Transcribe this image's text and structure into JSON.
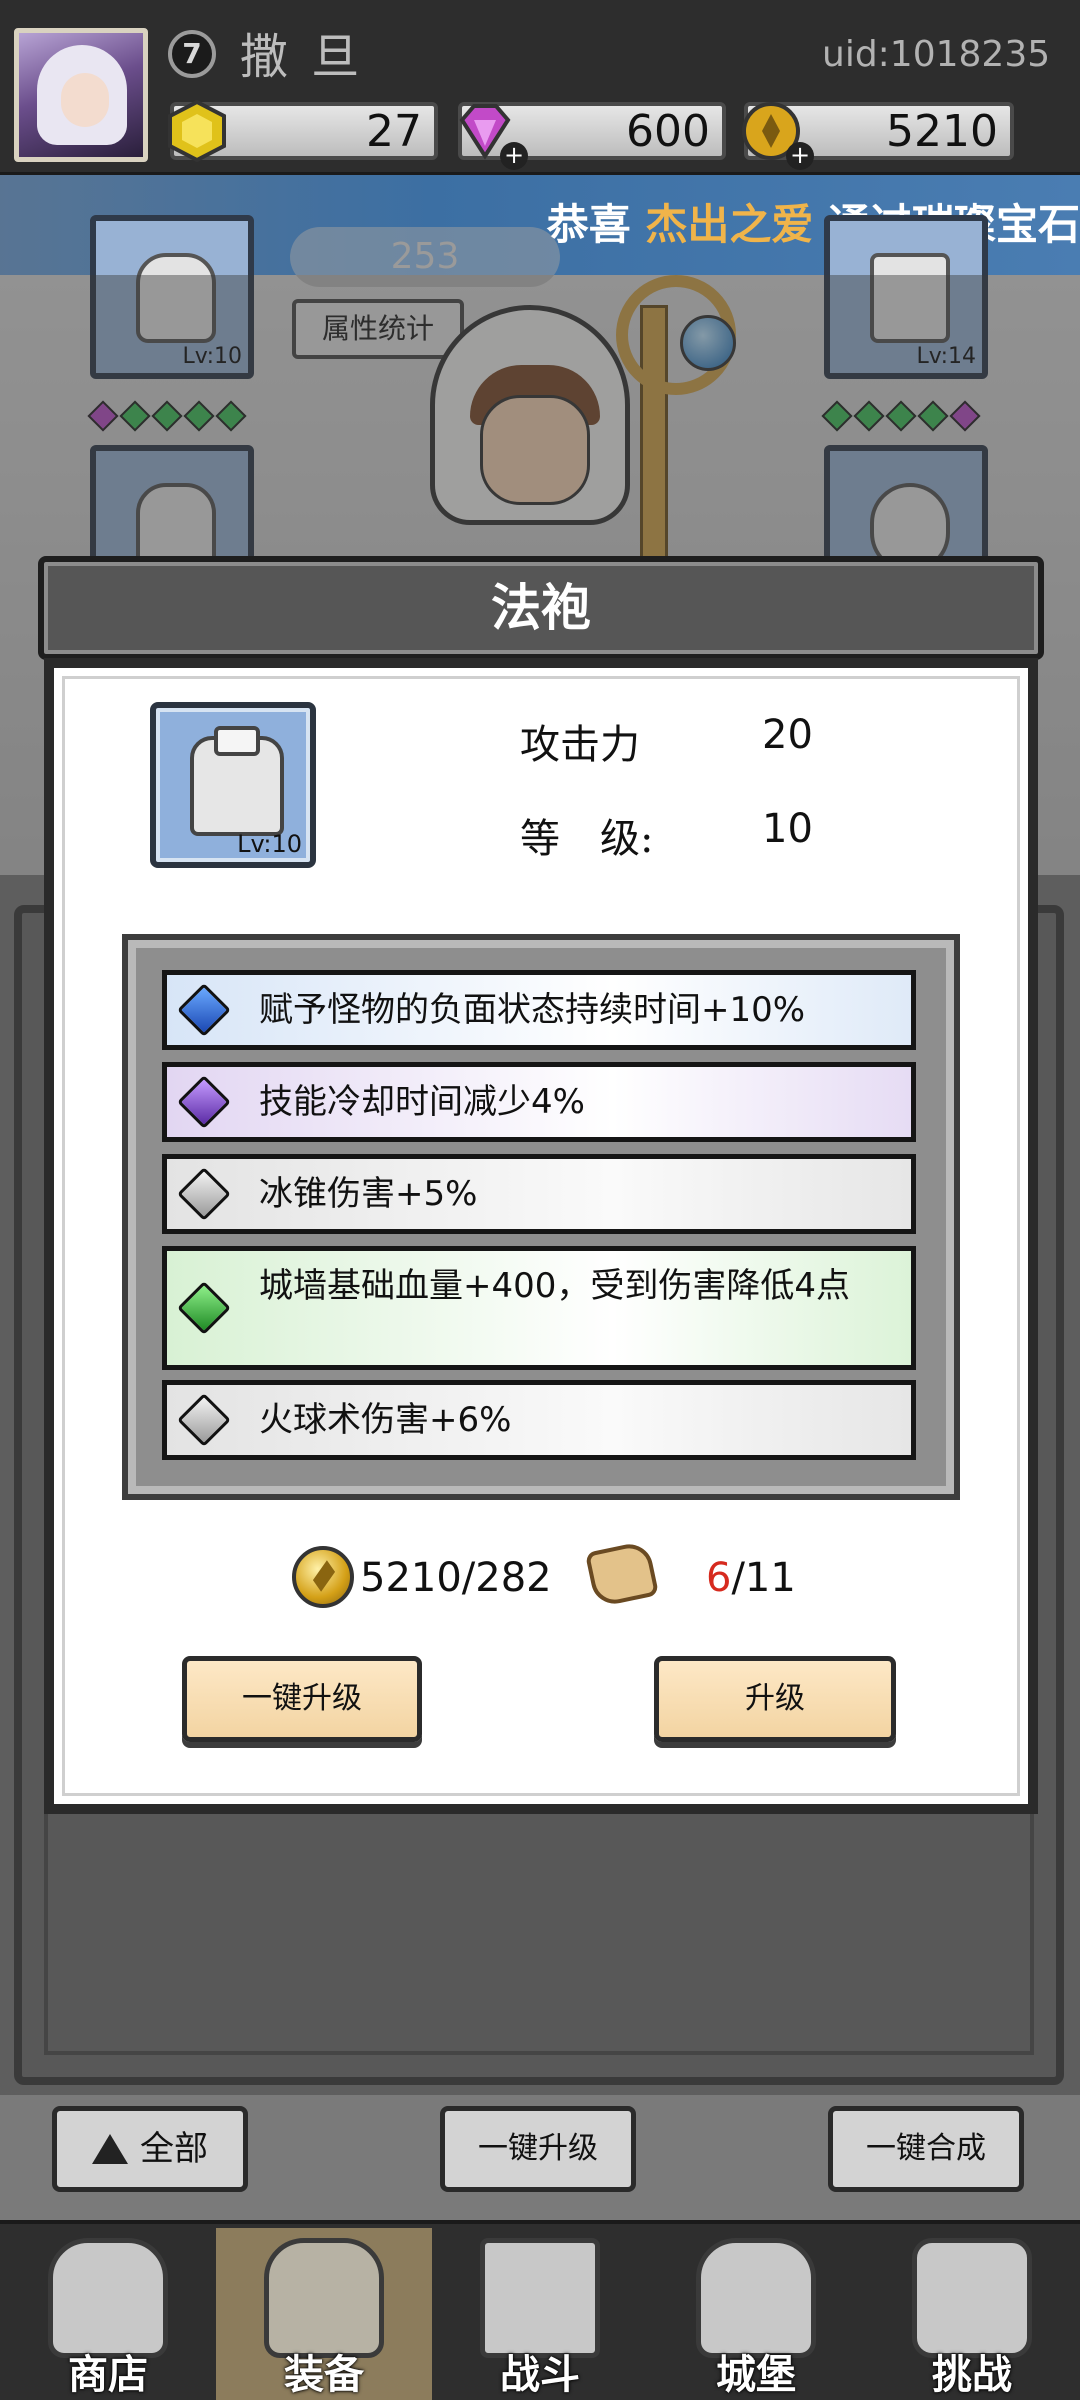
{
  "header": {
    "level": "7",
    "player_name": "撒 旦",
    "uid": "uid:1018235",
    "resources": {
      "gold_gem": "27",
      "diamond": "600",
      "coin": "5210"
    }
  },
  "banner": {
    "prefix": "恭喜",
    "player": "杰出之爱",
    "suffix": "通过璀璨宝石"
  },
  "scene": {
    "power": "253",
    "stat_button": "属性统计",
    "slot_levels": {
      "helmet": "Lv:10",
      "weapon": "Lv:14"
    }
  },
  "modal": {
    "title": "法袍",
    "item_level": "Lv:10",
    "stats": [
      {
        "label": "攻击力",
        "value": "20"
      },
      {
        "label": "等　级:",
        "value": "10"
      }
    ],
    "affixes": [
      {
        "gem": "blue",
        "text": "赋予怪物的负面状态持续时间+10%"
      },
      {
        "gem": "purple",
        "text": "技能冷却时间减少4%"
      },
      {
        "gem": "white",
        "text": "冰锥伤害+5%"
      },
      {
        "gem": "green",
        "text": "城墙基础血量+400，受到伤害降低4点"
      },
      {
        "gem": "white",
        "text": "火球术伤害+6%"
      }
    ],
    "cost": {
      "coins": "5210/282",
      "scroll_have": "6",
      "scroll_need": "/11"
    },
    "buttons": {
      "upgrade_all": "一键升级",
      "upgrade": "升级"
    }
  },
  "actions": {
    "all": "全部",
    "upgrade_all": "一键升级",
    "merge_all": "一键合成"
  },
  "nav": {
    "items": [
      {
        "label": "商店",
        "icon": "shop-hut-icon"
      },
      {
        "label": "装备",
        "icon": "backpack-icon",
        "active": true
      },
      {
        "label": "战斗",
        "icon": "crossed-swords-icon"
      },
      {
        "label": "城堡",
        "icon": "castle-icon"
      },
      {
        "label": "挑战",
        "icon": "locked-shield-icon"
      }
    ]
  },
  "colors": {
    "accent_highlight": "#f0b44a",
    "scroll_have_red": "#d62a1e",
    "button_cream": "#fde8c6",
    "banner_blue": "#3c6fa3"
  }
}
